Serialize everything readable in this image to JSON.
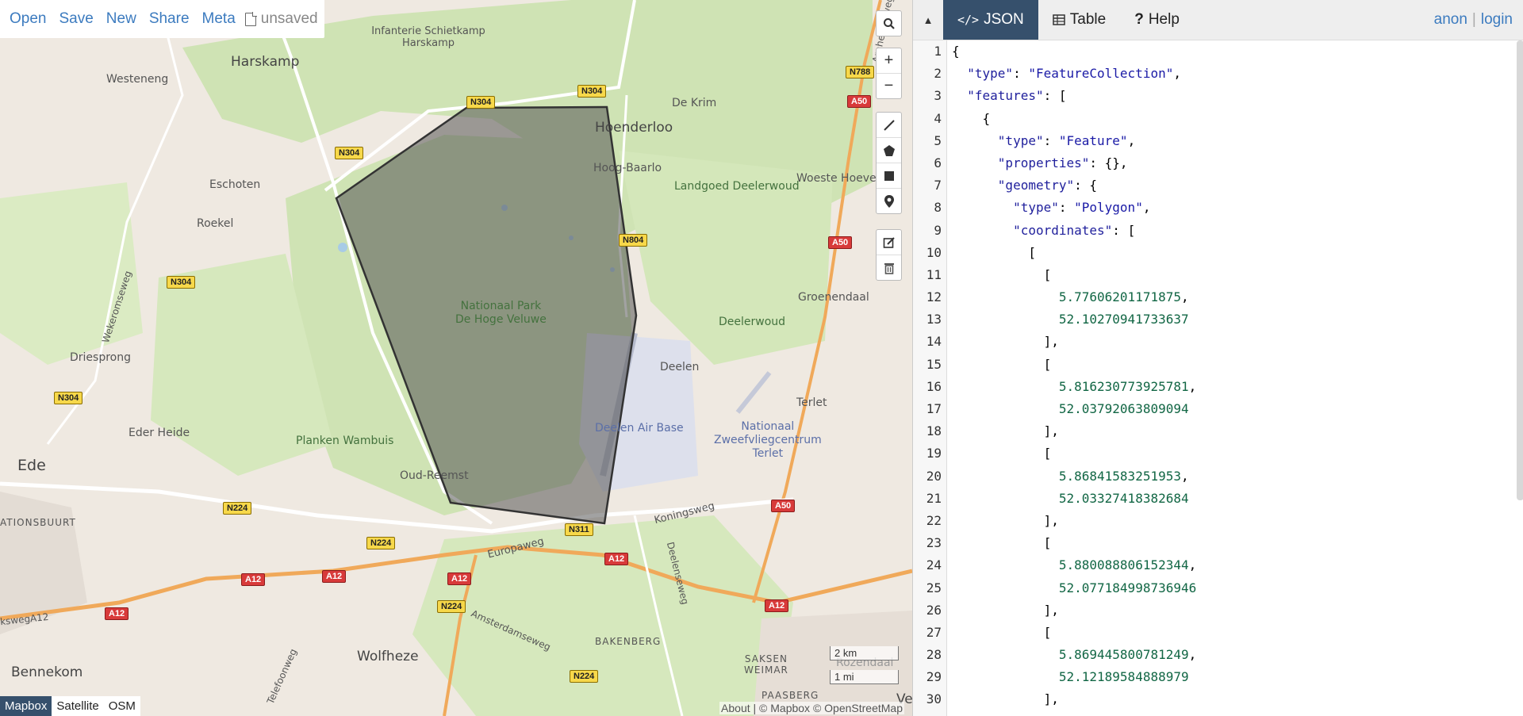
{
  "toolbar": {
    "open": "Open",
    "save": "Save",
    "new": "New",
    "share": "Share",
    "meta": "Meta",
    "file_status": "unsaved"
  },
  "map": {
    "labels": {
      "harskamp": "Harskamp",
      "westeneng": "Westeneng",
      "infanterie": "Infanterie Schietkamp Harskamp",
      "dekrim": "De Krim",
      "hoenderloo": "Hoenderloo",
      "hoogbaarlo": "Hoog-Baarlo",
      "landgoed": "Landgoed Deelerwoud",
      "woeste": "Woeste Hoeve",
      "eschoten": "Eschoten",
      "roekel": "Roekel",
      "wekeromseweg": "Wekeromseweg",
      "nationaal_park": "Nationaal Park\nDe Hoge Veluwe",
      "groenendaal": "Groenendaal",
      "deelerwoud": "Deelerwoud",
      "driesprong": "Driesprong",
      "deelen": "Deelen",
      "terlet": "Terlet",
      "deelen_air": "Deelen Air Base",
      "zweefvlieg": "Nationaal\nZweefvliegcentrum\nTerlet",
      "ederheide": "Eder Heide",
      "planken": "Planken Wambuis",
      "ede": "Ede",
      "oudreemst": "Oud-Reemst",
      "koningsweg": "Koningsweg",
      "ationsbuurt": "ATIONSBUURT",
      "europaweg": "Europaweg",
      "deelenseweg": "Deelenseweg",
      "amsterdamseweg": "Amsterdamseweg",
      "kswega12": "kswegA12",
      "bakenberg": "BAKENBERG",
      "sakesenweimar": "SAKSEN\nWEIMAR",
      "rozendaal": "Rozendaal",
      "bennekom": "Bennekom",
      "wolfheze": "Wolfheze",
      "telefoonweg": "Telefoonweg",
      "paasberg": "PAASBERG",
      "ve": "Ve",
      "arnhemseweg": "Arnhemseweg"
    },
    "shields": {
      "n304a": "N304",
      "n304b": "N304",
      "n304c": "N304",
      "n304d": "N304",
      "n304e": "N304",
      "n788": "N788",
      "a50a": "A50",
      "a50b": "A50",
      "a50c": "A50",
      "n804": "N804",
      "n311": "N311",
      "n224a": "N224",
      "n224b": "N224",
      "n224c": "N224",
      "n224d": "N224",
      "a12a": "A12",
      "a12b": "A12",
      "a12c": "A12",
      "a12d": "A12",
      "a12e": "A12",
      "a12f": "A12"
    },
    "layers": {
      "mapbox": "Mapbox",
      "satellite": "Satellite",
      "osm": "OSM"
    },
    "scale": {
      "km": "2 km",
      "mi": "1 mi"
    },
    "attribution": "About | © Mapbox © OpenStreetMap",
    "colors": {
      "polygon_fill": "#555555",
      "polygon_stroke": "#333333",
      "active_tab": "#36506c",
      "link": "#3c7bbf"
    }
  },
  "panel": {
    "tabs": {
      "json": "JSON",
      "table": "Table",
      "help": "Help"
    },
    "auth": {
      "user": "anon",
      "sep": "|",
      "login": "login"
    },
    "line_numbers": [
      "1",
      "2",
      "3",
      "4",
      "5",
      "6",
      "7",
      "8",
      "9",
      "10",
      "11",
      "12",
      "13",
      "14",
      "15",
      "16",
      "17",
      "18",
      "19",
      "20",
      "21",
      "22",
      "23",
      "24",
      "25",
      "26",
      "27",
      "28",
      "29",
      "30"
    ],
    "code_lines": [
      "{",
      "  \"type\": \"FeatureCollection\",",
      "  \"features\": [",
      "    {",
      "      \"type\": \"Feature\",",
      "      \"properties\": {},",
      "      \"geometry\": {",
      "        \"type\": \"Polygon\",",
      "        \"coordinates\": [",
      "          [",
      "            [",
      "              5.77606201171875,",
      "              52.10270941733637",
      "            ],",
      "            [",
      "              5.816230773925781,",
      "              52.03792063809094",
      "            ],",
      "            [",
      "              5.86841583251953,",
      "              52.03327418382684",
      "            ],",
      "            [",
      "              5.880088806152344,",
      "              52.077184998736946",
      "            ],",
      "            [",
      "              5.869445800781249,",
      "              52.12189584888979",
      "            ],"
    ]
  }
}
